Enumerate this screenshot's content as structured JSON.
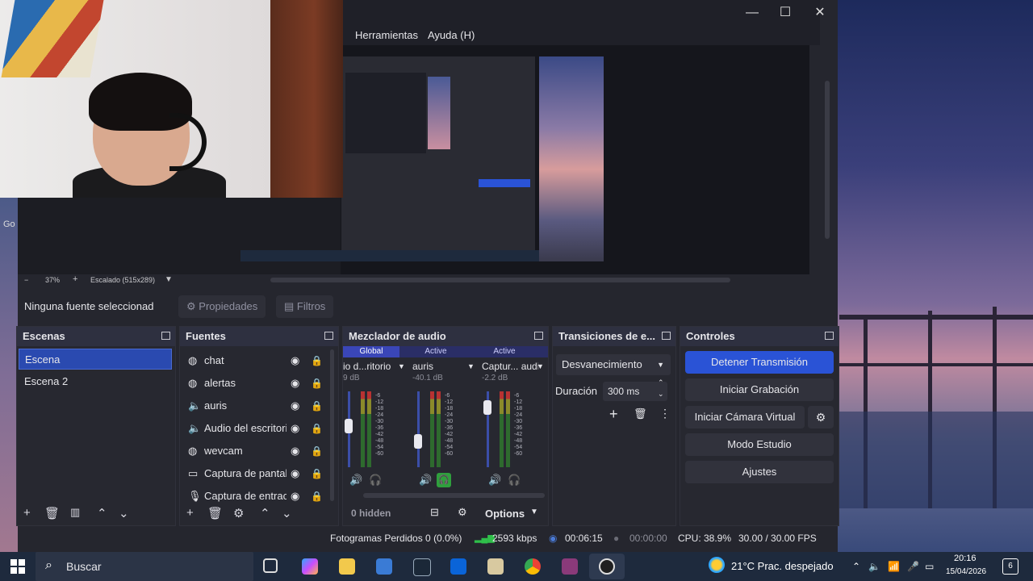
{
  "window": {
    "minimize": "—",
    "maximize": "☐",
    "close": "✕"
  },
  "menu": [
    "Herramientas",
    "Ayuda (H)"
  ],
  "preview_bar": {
    "zoom": "37%",
    "scale": "Escalado (515x289)"
  },
  "context_bar": {
    "no_source": "Ninguna fuente seleccionad",
    "properties": "Propiedades",
    "filters": "Filtros"
  },
  "scenes": {
    "title": "Escenas",
    "items": [
      "Escena",
      "Escena 2"
    ]
  },
  "sources": {
    "title": "Fuentes",
    "items": [
      {
        "label": "chat",
        "icon": "globe-icon"
      },
      {
        "label": "alertas",
        "icon": "globe-icon"
      },
      {
        "label": "auris",
        "icon": "speaker-icon"
      },
      {
        "label": "Audio del escritori",
        "icon": "speaker-icon"
      },
      {
        "label": "wevcam",
        "icon": "globe-icon"
      },
      {
        "label": "Captura de pantal",
        "icon": "monitor-icon"
      },
      {
        "label": "Captura de entrac",
        "icon": "mic-icon"
      }
    ]
  },
  "mixer": {
    "title": "Mezclador de audio",
    "tabs": [
      "Global",
      "Active",
      "Active"
    ],
    "channels": [
      {
        "name": "io d...ritorio",
        "db": "9 dB",
        "level": 0.55
      },
      {
        "name": "auris",
        "db": "-40.1 dB",
        "level": 0.3
      },
      {
        "name": "Captur... audio",
        "db": "-2.2 dB",
        "level": 0.85
      }
    ],
    "ticks": [
      "-6",
      "-12",
      "-18",
      "-24",
      "-30",
      "-36",
      "-42",
      "-48",
      "-54",
      "-60"
    ],
    "hidden": "0 hidden",
    "options": "Options"
  },
  "transitions": {
    "title": "Transiciones de e...",
    "type": "Desvanecimiento",
    "duration_label": "Duración",
    "duration_value": "300 ms"
  },
  "controls": {
    "title": "Controles",
    "buttons": [
      "Detener Transmisión",
      "Iniciar Grabación",
      "Iniciar Cámara Virtual",
      "Modo Estudio",
      "Ajustes"
    ]
  },
  "status": {
    "dropped": "Fotogramas Perdidos 0 (0.0%)",
    "bitrate": "2593 kbps",
    "stream_time": "00:06:15",
    "rec_time": "00:00:00",
    "cpu": "CPU: 38.9%",
    "fps": "30.00 / 30.00 FPS"
  },
  "taskbar": {
    "search": "Buscar",
    "weather": "21°C  Prac. despejado",
    "time": "20:16",
    "date": "15/04/2026",
    "notifications": "6"
  },
  "desktop_label": "Go"
}
